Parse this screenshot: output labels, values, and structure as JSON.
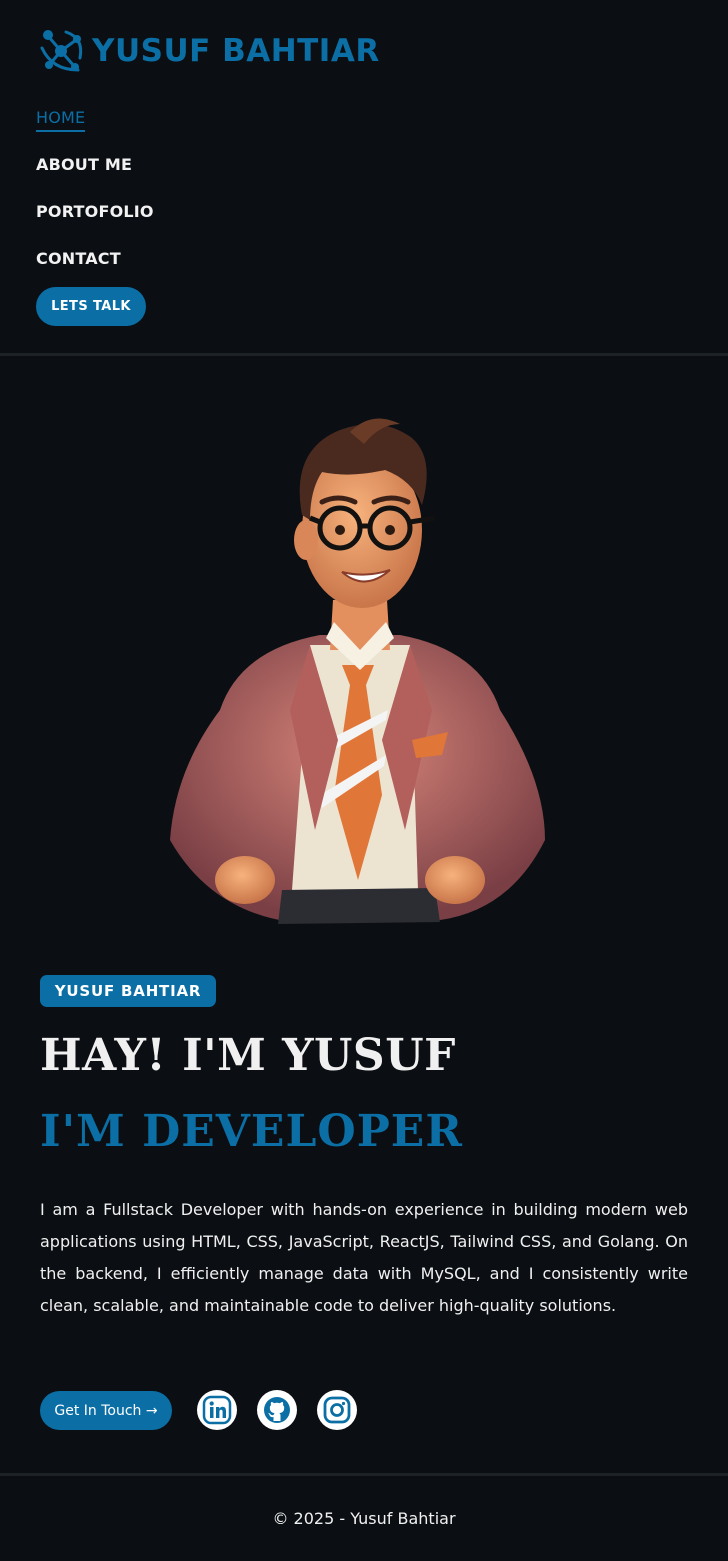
{
  "header": {
    "logo_text": "YUSUF BAHTIAR",
    "logo_icon": "molecule-icon",
    "nav": [
      {
        "label": "HOME",
        "active": true
      },
      {
        "label": "ABOUT ME",
        "active": false
      },
      {
        "label": "PORTOFOLIO",
        "active": false
      },
      {
        "label": "CONTACT",
        "active": false
      }
    ],
    "talk_button": "LETS TALK"
  },
  "hero": {
    "badge": "YUSUF BAHTIAR",
    "title": "HAY! I'M YUSUF",
    "subtitle": "I'M DEVELOPER",
    "bio": "I am a Fullstack Developer with hands-on experience in building modern web applications using HTML, CSS, JavaScript, ReactJS, Tailwind CSS, and Golang. On the backend, I efficiently manage data with MySQL, and I consistently write clean, scalable, and maintainable code to deliver high-quality solutions.",
    "cta_label": "Get In Touch →",
    "social": [
      {
        "icon": "linkedin-icon"
      },
      {
        "icon": "github-icon"
      },
      {
        "icon": "instagram-icon"
      }
    ],
    "avatar_icon": "avatar-illustration"
  },
  "footer": {
    "copyright": "© 2025 - Yusuf Bahtiar"
  },
  "colors": {
    "background": "#0b0f13",
    "accent": "#0b6fa6",
    "text": "#f0f0f0",
    "divider": "#1d2227"
  }
}
